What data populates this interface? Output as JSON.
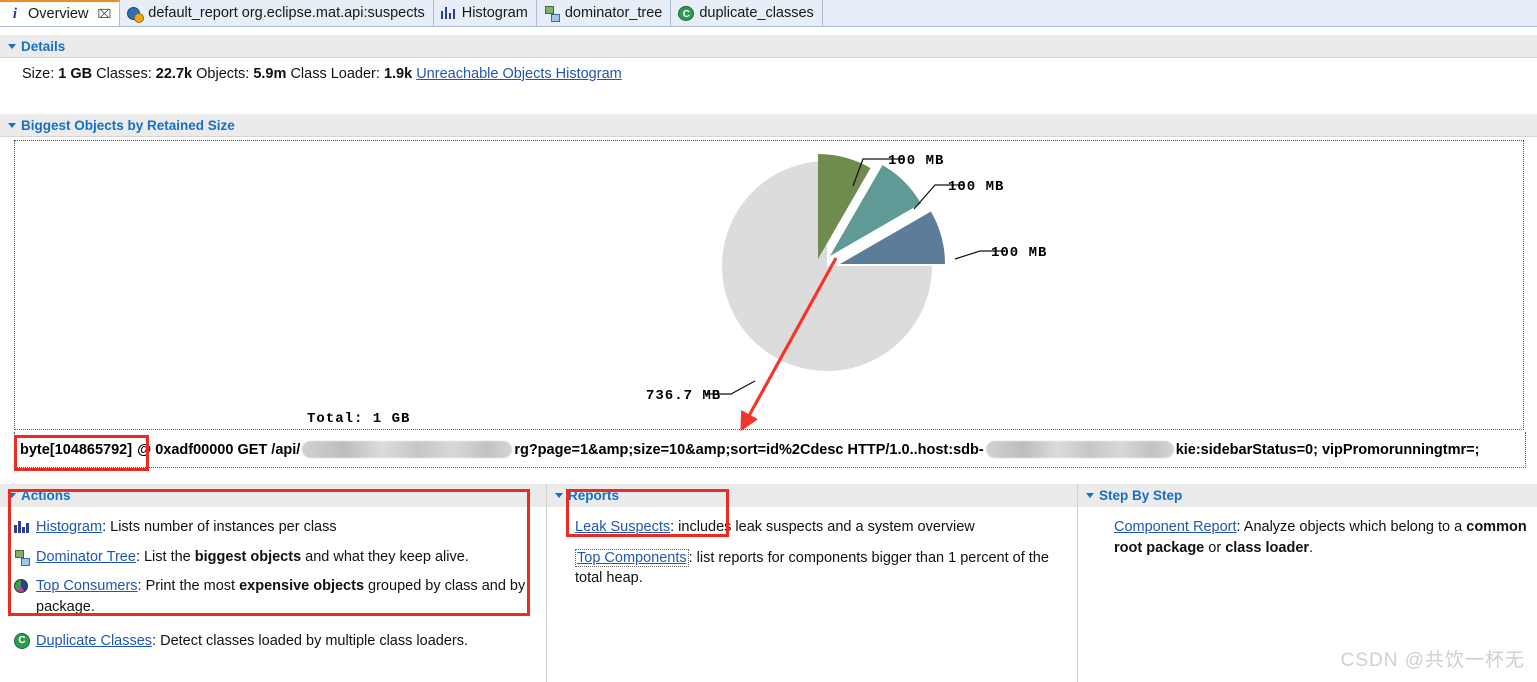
{
  "tabs": [
    {
      "label": "Overview",
      "icon": "info-icon",
      "active": true,
      "closable": true,
      "close_glyph": "⌧"
    },
    {
      "label": "default_report  org.eclipse.mat.api:suspects",
      "icon": "report-icon",
      "active": false,
      "closable": false
    },
    {
      "label": "Histogram",
      "icon": "histogram-icon",
      "active": false,
      "closable": false
    },
    {
      "label": "dominator_tree",
      "icon": "tree-icon",
      "active": false,
      "closable": false
    },
    {
      "label": "duplicate_classes",
      "icon": "duplicate-classes-icon",
      "active": false,
      "closable": false
    }
  ],
  "details": {
    "header": "Details",
    "size_label": "Size:",
    "size_value": "1 GB",
    "classes_label": "Classes:",
    "classes_value": "22.7k",
    "objects_label": "Objects:",
    "objects_value": "5.9m",
    "classloader_label": "Class Loader:",
    "classloader_value": "1.9k",
    "unreachable_link": "Unreachable Objects Histogram"
  },
  "biggest": {
    "header": "Biggest Objects by Retained Size",
    "total_label": "Total: 1 GB",
    "byte_row": {
      "prefix": "byte[104865792]",
      "mid1": "@ 0xadf00000 GET /api/",
      "mid2": "rg?page=1&amp;size=10&amp;sort=id%2Cdesc HTTP/1.0..host:sdb-",
      "suffix": "kie:sidebarStatus=0; vipPromorunningtmr=;"
    }
  },
  "chart_data": {
    "type": "pie",
    "title": "Biggest Objects by Retained Size",
    "total": "1 GB",
    "unit": "MB",
    "labels": [
      "100 MB",
      "100 MB",
      "100 MB",
      "736.7 MB"
    ],
    "values": [
      100,
      100,
      100,
      736.7
    ],
    "colors": [
      "#6f8b4d",
      "#5f9a97",
      "#5c7d99",
      "#dcdcdc"
    ],
    "exploded": [
      true,
      true,
      true,
      false
    ],
    "legend": "none",
    "grid": false
  },
  "actions": {
    "header": "Actions",
    "items": [
      {
        "icon": "histogram-icon",
        "link": "Histogram",
        "text_before": ": Lists number of instances per class",
        "bold1": "",
        "text_mid": "",
        "bold2": "",
        "text_after": ""
      },
      {
        "icon": "tree-icon",
        "link": "Dominator Tree",
        "text_before": ": List the ",
        "bold1": "biggest objects",
        "text_mid": " and what they keep alive.",
        "bold2": "",
        "text_after": ""
      },
      {
        "icon": "pie-icon",
        "link": "Top Consumers",
        "text_before": ": Print the most ",
        "bold1": "expensive objects",
        "text_mid": " grouped by class and by package.",
        "bold2": "",
        "text_after": ""
      },
      {
        "icon": "duplicate-classes-icon",
        "link": "Duplicate Classes",
        "text_before": ": Detect classes loaded by multiple class loaders.",
        "bold1": "",
        "text_mid": "",
        "bold2": "",
        "text_after": ""
      }
    ]
  },
  "reports": {
    "header": "Reports",
    "items": [
      {
        "link": "Leak Suspects",
        "text": ": includes leak suspects and a system overview",
        "dotted": false
      },
      {
        "link": "Top Components",
        "text": ": list reports for components bigger than 1 percent of the total heap.",
        "dotted": true
      }
    ]
  },
  "step_by_step": {
    "header": "Step By Step",
    "items": [
      {
        "link": "Component Report",
        "text_before": ": Analyze objects which belong to a ",
        "bold1": "common root package",
        "text_mid": " or ",
        "bold2": "class loader",
        "text_after": "."
      }
    ]
  },
  "watermark": "CSDN @共饮一杯无",
  "colors": {
    "accent_blue": "#1570c6",
    "link_blue": "#1f57b5",
    "annotation_red": "#ee2a24",
    "tab_active_top": "#f08a24",
    "pie_green": "#6f8b4d",
    "pie_teal": "#5f9a97",
    "pie_steel": "#5c7d99",
    "pie_gray": "#dcdcdc"
  }
}
